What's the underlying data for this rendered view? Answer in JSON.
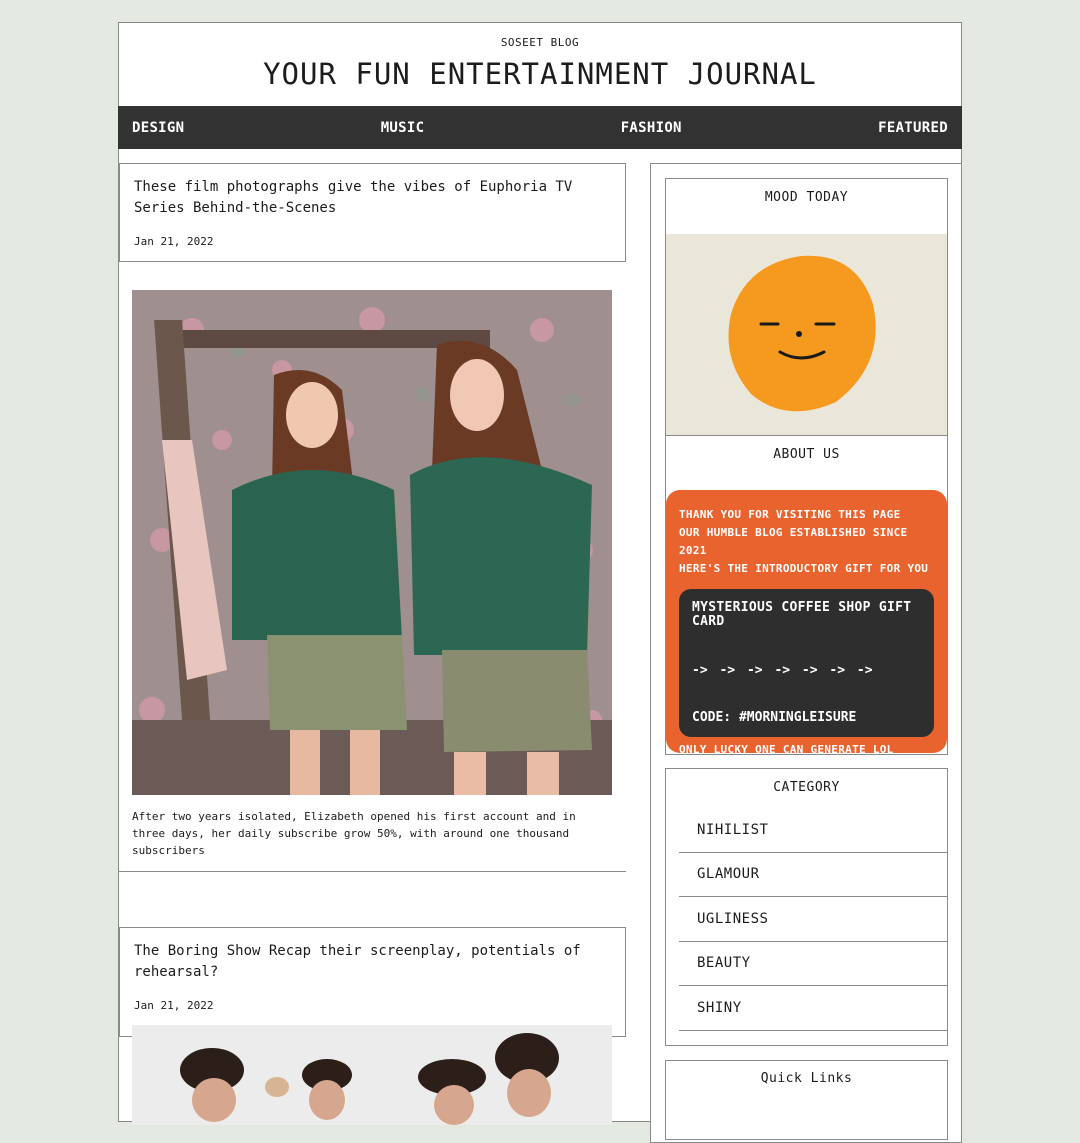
{
  "header": {
    "brand": "SOSEET BLOG",
    "title": "YOUR FUN ENTERTAINMENT JOURNAL"
  },
  "nav": {
    "items": [
      "DESIGN",
      "MUSIC",
      "FASHION",
      "FEATURED"
    ]
  },
  "posts": [
    {
      "title": "These film photographs give the vibes of Euphoria TV Series Behind-the-Scenes",
      "date": "Jan 21, 2022",
      "caption": "After two years isolated, Elizabeth opened his first account and in three days, her daily subscribe grow 50%, with around one thousand subscribers"
    },
    {
      "title": "The Boring Show Recap their screenplay, potentials of rehearsal?",
      "date": "Jan 21, 2022"
    }
  ],
  "sidebar": {
    "mood_title": "MOOD TODAY",
    "about_title": "ABOUT US",
    "about_lines": [
      "THANK YOU FOR VISITING THIS PAGE",
      "OUR HUMBLE BLOG ESTABLISHED SINCE 2021",
      "HERE'S THE INTRODUCTORY GIFT FOR YOU"
    ],
    "gift": {
      "title": "MYSTERIOUS COFFEE SHOP GIFT CARD",
      "arrows": "-> -> -> -> -> -> ->",
      "code": "CODE: #MORNINGLEISURE"
    },
    "lucky_note": "ONLY LUCKY ONE CAN GENERATE LOL",
    "category_title": "CATEGORY",
    "categories": [
      "NIHILIST",
      "GLAMOUR",
      "UGLINESS",
      "BEAUTY",
      "SHINY"
    ],
    "quick_links_title": "Quick Links"
  },
  "colors": {
    "background": "#e3e8e1",
    "nav_bar": "#323232",
    "about_card": "#e8632d",
    "gift_card": "#2e2e2e",
    "smiley": "#f59a1e"
  }
}
